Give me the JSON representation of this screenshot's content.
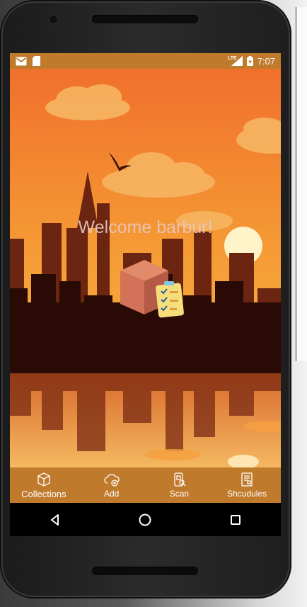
{
  "status_bar": {
    "time": "7:07",
    "network_label": "LTE"
  },
  "main": {
    "welcome_text": "Welcome barbur!"
  },
  "bottom_nav": {
    "items": [
      {
        "label": "Collections",
        "icon": "collections-box-icon"
      },
      {
        "label": "Add",
        "icon": "cloud-add-icon"
      },
      {
        "label": "Scan",
        "icon": "phone-scan-icon"
      },
      {
        "label": "Shcudules",
        "icon": "schedule-document-icon"
      }
    ]
  },
  "colors": {
    "accent": "#c07a2c",
    "sky_top": "#f07a2c",
    "sky_bottom": "#f7c94a",
    "silhouette": "#2a0a04"
  }
}
